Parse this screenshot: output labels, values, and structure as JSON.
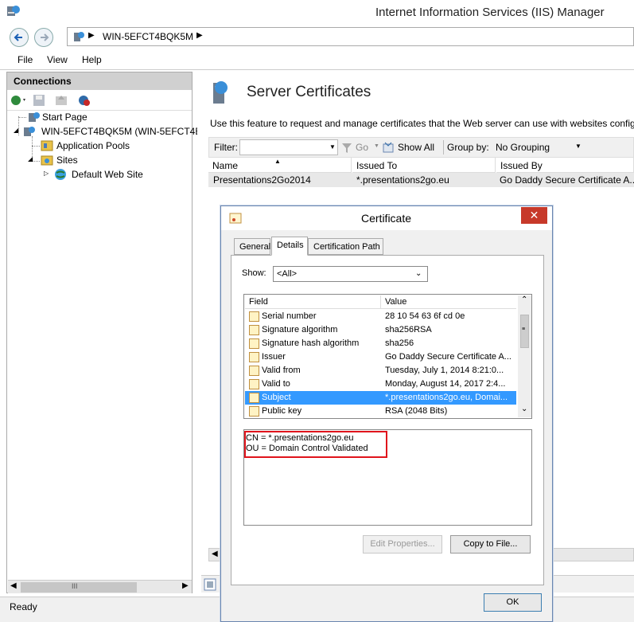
{
  "window": {
    "title": "Internet Information Services (IIS) Manager"
  },
  "address": {
    "path": [
      "WIN-5EFCT4BQK5M"
    ]
  },
  "menu": {
    "items": [
      "File",
      "View",
      "Help"
    ]
  },
  "connections": {
    "header": "Connections",
    "tree": [
      {
        "label": "Start Page",
        "icon": "start-page-icon"
      },
      {
        "label": "WIN-5EFCT4BQK5M (WIN-5EFCT4B",
        "icon": "server-icon"
      },
      {
        "label": "Application Pools",
        "icon": "app-pool-icon"
      },
      {
        "label": "Sites",
        "icon": "sites-icon"
      },
      {
        "label": "Default Web Site",
        "icon": "globe-icon"
      }
    ],
    "hscroll_thumb": "III"
  },
  "main": {
    "title": "Server Certificates",
    "description": "Use this feature to request and manage certificates that the Web server can use with websites configu",
    "filter": {
      "label": "Filter:",
      "value": "",
      "go": "Go",
      "show_all": "Show All",
      "group_by_label": "Group by:",
      "group_by_value": "No Grouping"
    },
    "columns": [
      "Name",
      "Issued To",
      "Issued By"
    ],
    "rows": [
      {
        "name": "Presentations2Go2014",
        "issued_to": "*.presentations2go.eu",
        "issued_by": "Go Daddy Secure Certificate A..."
      }
    ]
  },
  "status": {
    "text": "Ready"
  },
  "dialog": {
    "title": "Certificate",
    "close": "✕",
    "tabs": [
      "General",
      "Details",
      "Certification Path"
    ],
    "active_tab": "Details",
    "show_label": "Show:",
    "show_value": "<All>",
    "list_columns": [
      "Field",
      "Value"
    ],
    "fields": [
      {
        "field": "Serial number",
        "value": "28 10 54 63 6f cd 0e"
      },
      {
        "field": "Signature algorithm",
        "value": "sha256RSA"
      },
      {
        "field": "Signature hash algorithm",
        "value": "sha256"
      },
      {
        "field": "Issuer",
        "value": "Go Daddy Secure Certificate A..."
      },
      {
        "field": "Valid from",
        "value": "Tuesday, July 1, 2014 8:21:0..."
      },
      {
        "field": "Valid to",
        "value": "Monday, August 14, 2017 2:4..."
      },
      {
        "field": "Subject",
        "value": "*.presentations2go.eu, Domai..."
      },
      {
        "field": "Public key",
        "value": "RSA (2048 Bits)"
      }
    ],
    "selected_field": "Subject",
    "detail_lines": [
      "CN = *.presentations2go.eu",
      "OU = Domain Control Validated"
    ],
    "highlight_color": "#e0141c",
    "buttons": {
      "edit_properties": "Edit Properties...",
      "copy_to_file": "Copy to File...",
      "ok": "OK"
    }
  }
}
